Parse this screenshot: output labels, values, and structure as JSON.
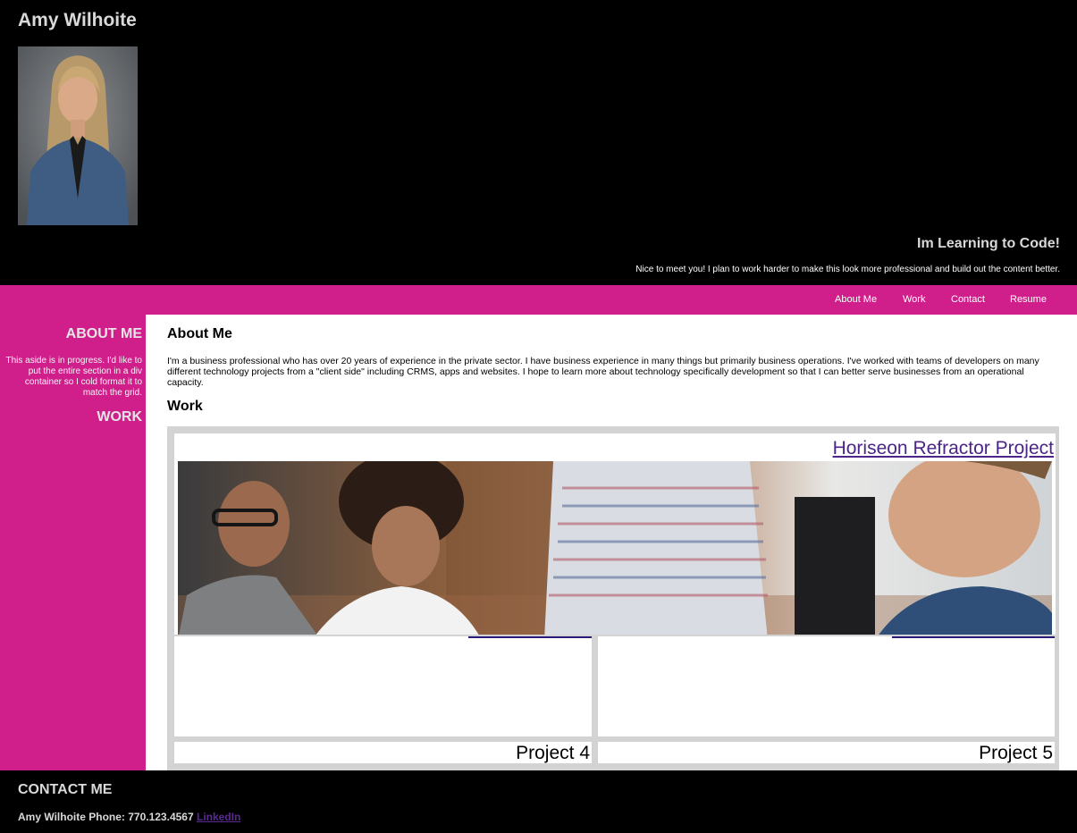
{
  "header": {
    "name": "Amy Wilhoite",
    "tagline": "Im Learning to Code!",
    "intro": "Nice to meet you! I plan to work harder to make this look more professional and build out the content better."
  },
  "nav": {
    "items": [
      {
        "label": "About Me"
      },
      {
        "label": "Work"
      },
      {
        "label": "Contact"
      },
      {
        "label": "Resume"
      }
    ]
  },
  "aside": {
    "about_heading": "ABOUT ME",
    "note": "This aside is in progress. I'd like to put the entire section in a div container so I cold format it to match the grid.",
    "work_heading": "WORK"
  },
  "main": {
    "about_heading": "About Me",
    "about_text": "I'm a business professional who has over 20 years of experience in the private sector. I have business experience in many things but primarily business operations. I've worked with teams of developers on many different technology projects from a \"client side\" including CRMS, apps and websites. I hope to learn more about technology specifically development so that I can better serve businesses from an operational capacity.",
    "work_heading": "Work",
    "featured_project": "Horiseon Refractor Project",
    "projects": [
      "Project 4",
      "Project 5"
    ]
  },
  "footer": {
    "heading": "CONTACT ME",
    "contact_text": "Amy Wilhoite Phone: 770.123.4567",
    "linkedin_label": "LinkedIn"
  },
  "colors": {
    "accent": "#d01f8b",
    "background_dark": "#000000",
    "link": "#4b2587"
  }
}
